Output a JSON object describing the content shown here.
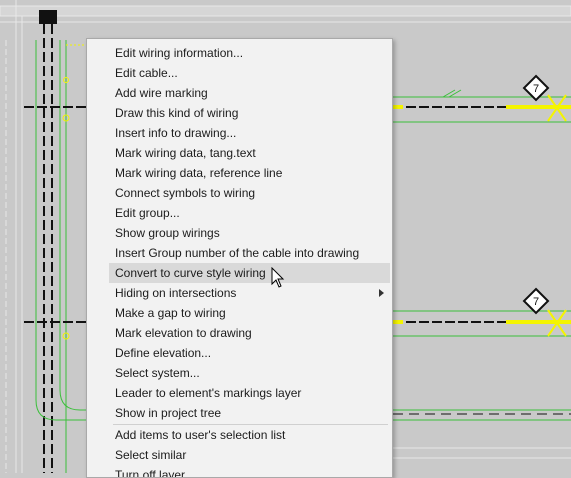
{
  "colors": {
    "canvas_bg": "#c9c9c9",
    "wire_green": "#3bbf3b",
    "highlight_yellow": "#f4f400",
    "menu_bg": "#f2f2f2",
    "menu_hover": "#d9d9d9"
  },
  "drawing": {
    "symbol_label_top": "7",
    "symbol_label_bottom": "7"
  },
  "context_menu": {
    "items": [
      {
        "label": "Edit wiring information..."
      },
      {
        "label": "Edit cable..."
      },
      {
        "label": "Add wire marking"
      },
      {
        "label": "Draw this kind of wiring"
      },
      {
        "label": "Insert info to drawing..."
      },
      {
        "label": "Mark wiring data, tang.text"
      },
      {
        "label": "Mark wiring data, reference line"
      },
      {
        "label": "Connect symbols to wiring"
      },
      {
        "label": "Edit group..."
      },
      {
        "label": "Show group wirings"
      },
      {
        "label": "Insert Group number of the cable into drawing"
      },
      {
        "label": "Convert to curve style wiring",
        "hovered": true
      },
      {
        "label": "Hiding on intersections",
        "submenu": true
      },
      {
        "label": "Make a gap to wiring"
      },
      {
        "label": "Mark elevation to drawing"
      },
      {
        "label": "Define elevation..."
      },
      {
        "label": "Select system..."
      },
      {
        "label": "Leader to element's markings layer"
      },
      {
        "label": "Show in project tree"
      },
      {
        "label": "Add items to user's selection list"
      },
      {
        "label": "Select similar"
      },
      {
        "label": "Turn off layer"
      }
    ]
  }
}
